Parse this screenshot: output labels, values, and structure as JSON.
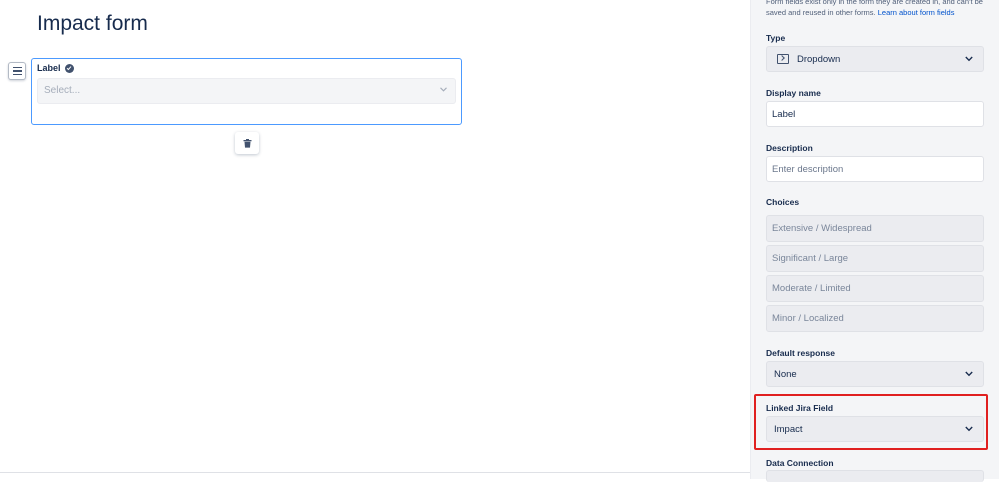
{
  "main": {
    "form_title": "Impact form",
    "field": {
      "label": "Label",
      "placeholder": "Select..."
    }
  },
  "panel": {
    "intro_text": "Form fields exist only in the form they are created in, and can't be saved and reused in other forms.",
    "intro_link": "Learn about form fields",
    "type": {
      "label": "Type",
      "value": "Dropdown",
      "icon": "dropdown-icon"
    },
    "display_name": {
      "label": "Display name",
      "value": "Label"
    },
    "description": {
      "label": "Description",
      "placeholder": "Enter description"
    },
    "choices": {
      "label": "Choices",
      "items": [
        "Extensive / Widespread",
        "Significant / Large",
        "Moderate / Limited",
        "Minor / Localized"
      ]
    },
    "default_response": {
      "label": "Default response",
      "value": "None"
    },
    "linked_jira_field": {
      "label": "Linked Jira Field",
      "value": "Impact"
    },
    "data_connection": {
      "label": "Data Connection"
    }
  },
  "colors": {
    "accent": "#4c9aff",
    "highlight": "#e02020",
    "link": "#0052cc"
  }
}
